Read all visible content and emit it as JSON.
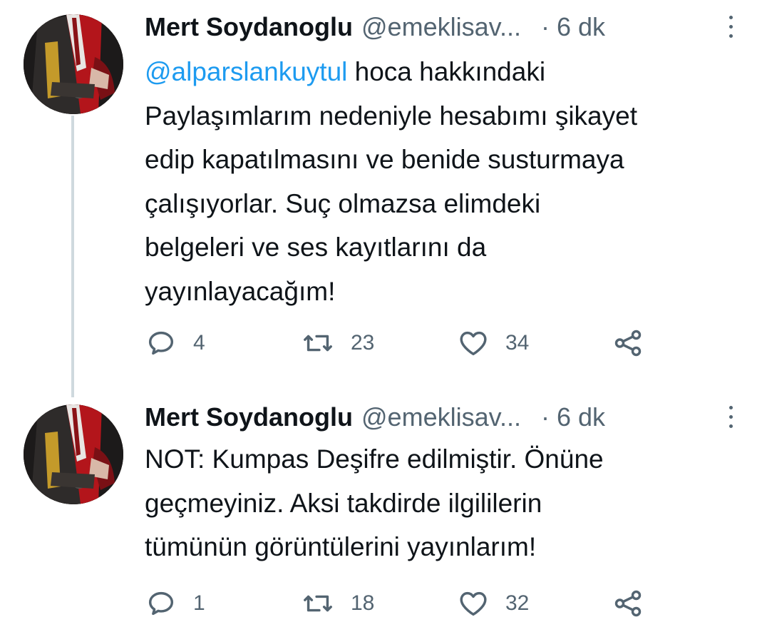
{
  "tweets": [
    {
      "name": "Mert Soydanoglu",
      "handle": "@emeklisav...",
      "separator": "·",
      "time": "6 dk",
      "mention": "@alparslankuytul",
      "body_lines": [
        " hoca hakkındaki",
        "Paylaşımlarım nedeniyle hesabımı şikayet",
        "edip kapatılmasını ve benide susturmaya",
        "çalışıyorlar. Suç olmazsa elimdeki",
        "belgeleri ve ses kayıtlarını da",
        "yayınlayacağım!"
      ],
      "replies": "4",
      "retweets": "23",
      "likes": "34"
    },
    {
      "name": "Mert Soydanoglu",
      "handle": "@emeklisav...",
      "separator": "·",
      "time": "6 dk",
      "body_lines": [
        "NOT: Kumpas Deşifre edilmiştir. Önüne",
        "geçmeyiniz. Aksi takdirde ilgililerin",
        "tümünün görüntülerini yayınlarım!"
      ],
      "replies": "1",
      "retweets": "18",
      "likes": "32"
    }
  ],
  "icons": {
    "reply": "reply-icon",
    "retweet": "retweet-icon",
    "like": "heart-icon",
    "share": "share-icon",
    "more": "more-vertical-icon"
  },
  "colors": {
    "text": "#0f1419",
    "secondary": "#536471",
    "link": "#1d9bf0",
    "thread_line": "#cfd9de",
    "robe_red": "#b3151b"
  }
}
